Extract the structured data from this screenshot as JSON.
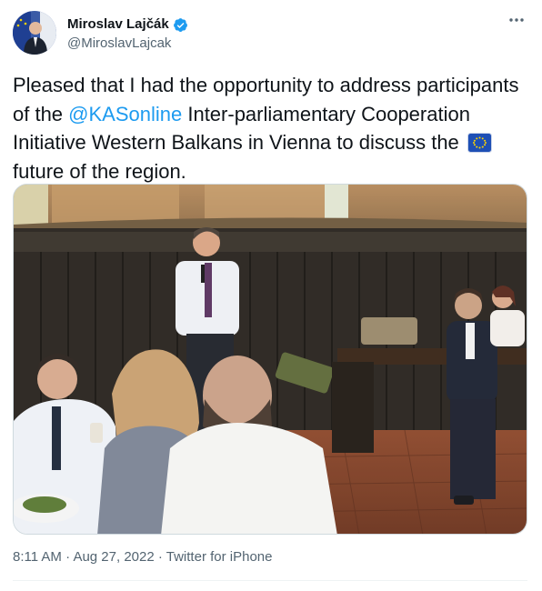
{
  "author": {
    "display_name": "Miroslav Lajčák",
    "handle": "@MiroslavLajcak",
    "verified": true,
    "avatar_icon": "profile-photo"
  },
  "tweet": {
    "text_part1": "Pleased that I had the opportunity to address participants of the ",
    "mention": "@KASonline",
    "text_part2": " Inter-parliamentary Cooperation Initiative Western Balkans in Vienna to discuss the ",
    "emoji": "eu-flag-icon",
    "text_part3": " future of the region."
  },
  "media": {
    "type": "photo"
  },
  "meta": {
    "time": "8:11 AM",
    "separator1": "·",
    "date": "Aug 27, 2022",
    "separator2": "·",
    "source": "Twitter for iPhone"
  },
  "colors": {
    "link": "#1d9bf0",
    "verified": "#1d9bf0",
    "secondary_text": "#536471"
  }
}
